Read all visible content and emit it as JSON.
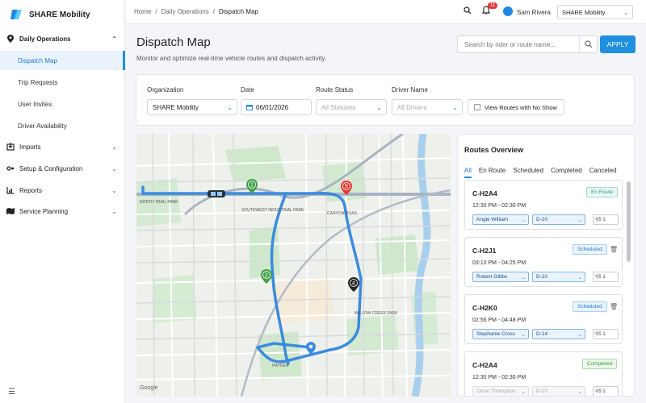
{
  "app": {
    "name": "SHARE Mobility"
  },
  "sidebar": {
    "sections": [
      {
        "label": "Daily Operations",
        "icon": "location-pin-icon",
        "expanded": true
      },
      {
        "label": "Imports",
        "icon": "import-icon"
      },
      {
        "label": "Setup & Configuration",
        "icon": "settings-icon"
      },
      {
        "label": "Reports",
        "icon": "chart-icon"
      },
      {
        "label": "Service Planning",
        "icon": "map-icon"
      }
    ],
    "items": [
      {
        "label": "Dispatch Map",
        "active": true
      },
      {
        "label": "Trip Requests"
      },
      {
        "label": "User Invites"
      },
      {
        "label": "Driver Availability"
      }
    ]
  },
  "topbar": {
    "breadcrumb": [
      "Home",
      "Daily Operations",
      "Dispatch Map"
    ],
    "notification_count": "11",
    "user_name": "Sam Rivera",
    "org_select": "SHARE Mobility"
  },
  "page": {
    "title": "Dispatch Map",
    "subtitle": "Monitor and optimize real-time vehicle routes and dispatch activity.",
    "search_placeholder": "Search by rider or route name...",
    "apply_label": "APPLY"
  },
  "filters": {
    "organization": {
      "label": "Organization",
      "value": "SHARE Mobility"
    },
    "date": {
      "label": "Date",
      "value": "06/01/2026"
    },
    "route_status": {
      "label": "Route Status",
      "placeholder": "All Statuses"
    },
    "driver_name": {
      "label": "Driver Name",
      "placeholder": "All Drivers"
    },
    "no_show_label": "View Routes with No Show"
  },
  "map": {
    "markers": [
      "1",
      "2",
      "4",
      "5"
    ],
    "labels": [
      "NORTH TRAIL PARK",
      "SOUTHWEST INDUSTRIAL PARK",
      "CANYON ROAD",
      "WILLOW CREEK PARK",
      "HAYDEN",
      "Google"
    ]
  },
  "routes_overview": {
    "title": "Routes Overview",
    "tabs": [
      "All",
      "En Route",
      "Scheduled",
      "Completed",
      "Canceled"
    ],
    "active_tab": "All",
    "routes": [
      {
        "name": "C-H2A4",
        "time": "12:30 PM - 02:30 PM",
        "status": "En Route",
        "driver": "Angie William",
        "vehicle": "D-10",
        "counts": "5  1"
      },
      {
        "name": "C-H2J1",
        "time": "03:10 PM - 04:25 PM",
        "status": "Scheduled",
        "driver": "Robert Gibbs",
        "vehicle": "D-10",
        "counts": "5  1"
      },
      {
        "name": "C-H2K0",
        "time": "02:56 PM - 04:48 PM",
        "status": "Scheduled",
        "driver": "Stephanie Cross",
        "vehicle": "D-14",
        "counts": "5  1"
      },
      {
        "name": "C-H2A4",
        "time": "12:30 PM - 02:30 PM",
        "status": "Completed",
        "driver": "Omar Thompson",
        "vehicle": "D-10",
        "counts": "5  1"
      }
    ]
  },
  "colors": {
    "primary": "#1f8fe0",
    "route": "#3b8be0",
    "marker_green": "#43a047",
    "marker_red": "#e53935"
  }
}
